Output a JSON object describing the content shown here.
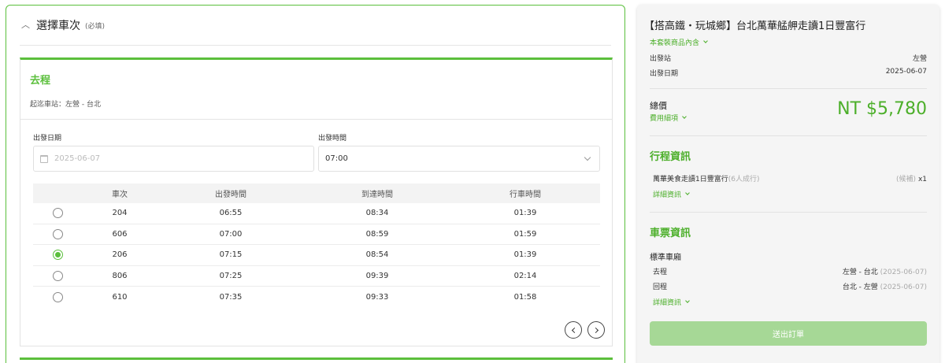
{
  "section": {
    "title": "選擇車次",
    "required": "(必填)"
  },
  "trip": {
    "title": "去程",
    "stations": "起迄車站：左營 - 台北",
    "date_label": "出發日期",
    "date_placeholder": "2025-06-07",
    "time_label": "出發時間",
    "time_value": "07:00"
  },
  "table": {
    "headers": [
      "車次",
      "出發時間",
      "到達時間",
      "行車時間"
    ],
    "rows": [
      {
        "train": "204",
        "depart": "06:55",
        "arrive": "08:34",
        "duration": "01:39",
        "selected": false
      },
      {
        "train": "606",
        "depart": "07:00",
        "arrive": "08:59",
        "duration": "01:59",
        "selected": false
      },
      {
        "train": "206",
        "depart": "07:15",
        "arrive": "08:54",
        "duration": "01:39",
        "selected": true
      },
      {
        "train": "806",
        "depart": "07:25",
        "arrive": "09:39",
        "duration": "02:14",
        "selected": false
      },
      {
        "train": "610",
        "depart": "07:35",
        "arrive": "09:33",
        "duration": "01:58",
        "selected": false
      }
    ]
  },
  "summary": {
    "title": "【搭高鐵・玩城鄉】台北萬華艋舺走讀1日豐富行",
    "package_link": "本套裝商品內含",
    "depart_station_label": "出發站",
    "depart_station_value": "左營",
    "depart_date_label": "出發日期",
    "depart_date_value": "2025-06-07",
    "total_label": "總價",
    "fee_link": "費用細項",
    "total_value": "NT $5,780",
    "itinerary_title": "行程資訊",
    "itinerary_item": "萬華美食走讀1日豐富行",
    "itinerary_item_note": "(6人成行)",
    "itinerary_status": "(候補)",
    "itinerary_qty": "x1",
    "detail_link": "詳細資訊",
    "ticket_title": "車票資訊",
    "car_type": "標準車廂",
    "outbound_label": "去程",
    "outbound_route": "左營 - 台北",
    "outbound_date": "(2025-06-07)",
    "return_label": "回程",
    "return_route": "台北 - 左營",
    "return_date": "(2025-06-07)",
    "detail_link_2": "詳細資訊",
    "submit": "送出訂單"
  },
  "colors": {
    "accent": "#5bbf3c",
    "submit_disabled": "#a6d896"
  },
  "icons": [
    "chevron-up-icon",
    "calendar-icon",
    "chevron-down-icon",
    "chevron-left-icon",
    "chevron-right-icon"
  ]
}
